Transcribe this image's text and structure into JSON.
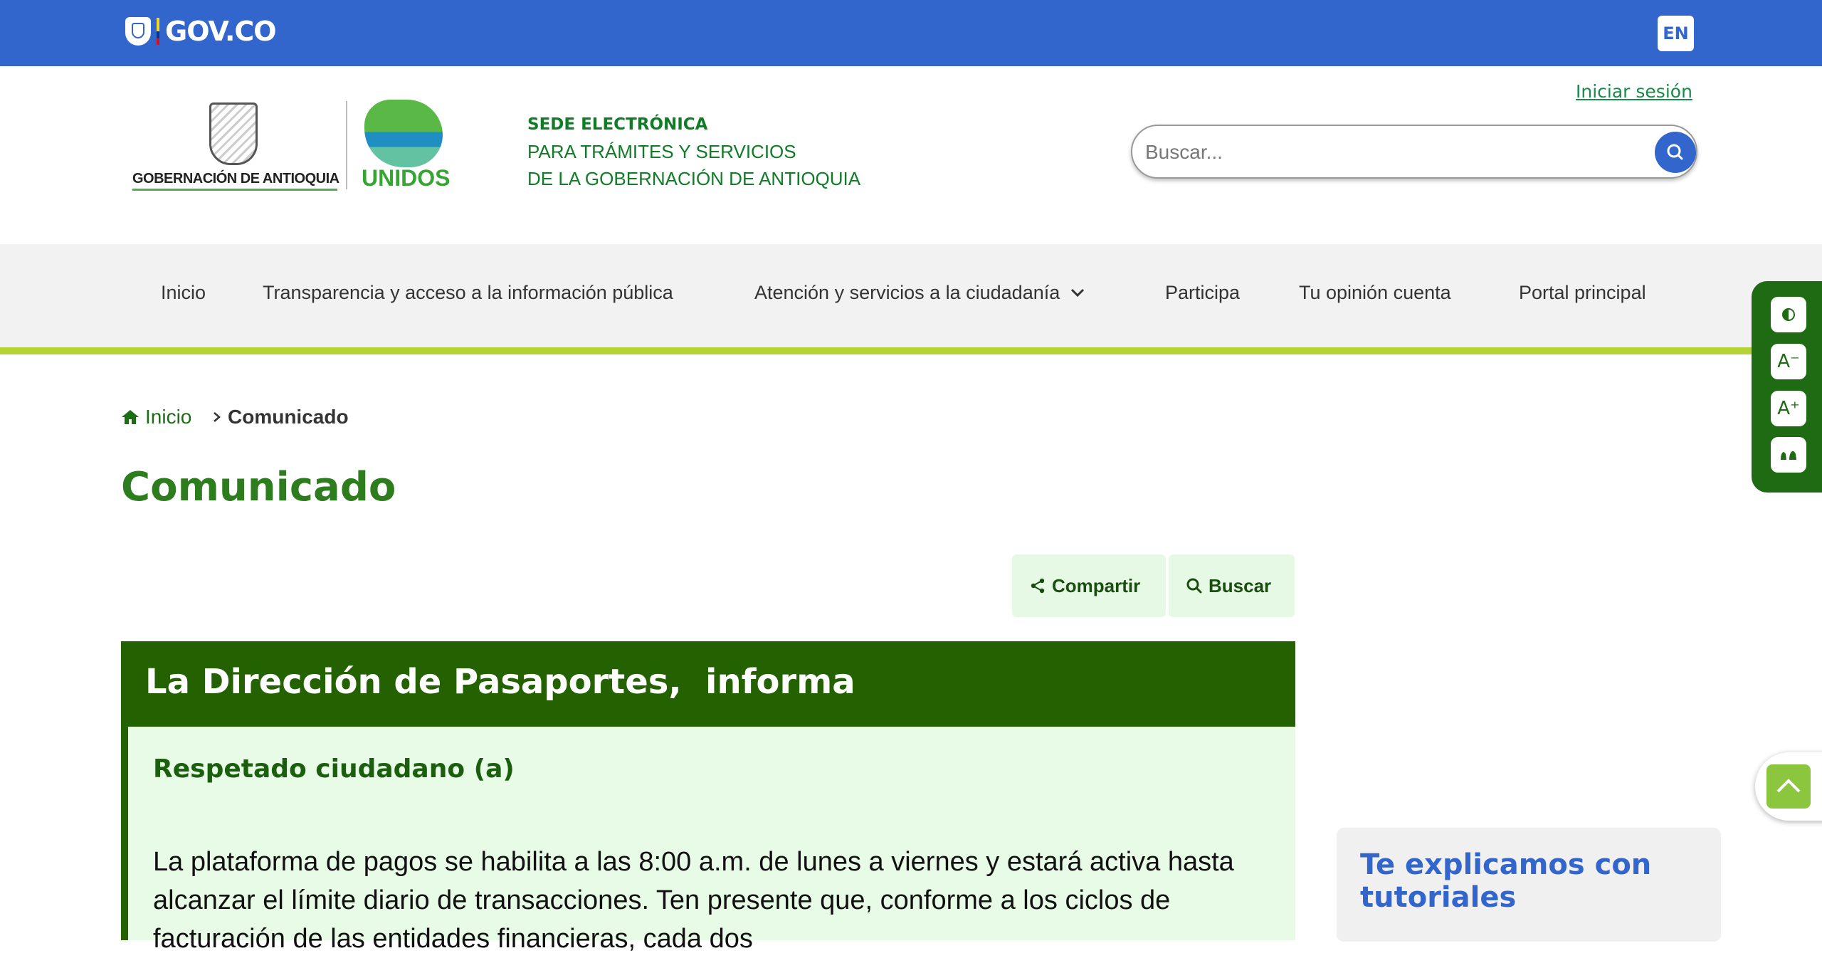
{
  "gov_bar": {
    "logo_text": "GOV.CO",
    "language_button": "EN"
  },
  "header": {
    "login_link": "Iniciar sesión",
    "gov_logo_text": "GOBERNACIÓN DE ANTIOQUIA",
    "unidos_logo_text": "UNIDOS",
    "sede_line1": "SEDE ELECTRÓNICA",
    "sede_line2": "PARA TRÁMITES Y SERVICIOS",
    "sede_line3": "DE LA GOBERNACIÓN DE ANTIOQUIA",
    "search_placeholder": "Buscar..."
  },
  "nav": {
    "items": [
      "Inicio",
      "Transparencia y acceso a la información pública",
      "Atención y servicios a la ciudadanía",
      "Participa",
      "Tu opinión cuenta",
      "Portal principal"
    ]
  },
  "accessibility": {
    "icons": [
      "contrast-icon",
      "decrease-font-icon",
      "increase-font-icon",
      "sign-language-icon"
    ]
  },
  "breadcrumb": {
    "home": "Inicio",
    "current": "Comunicado"
  },
  "page": {
    "title": "Comunicado"
  },
  "actions": {
    "share": "Compartir",
    "search": "Buscar"
  },
  "announcement": {
    "title": "La Dirección de Pasaportes,  informa",
    "greeting": "Respetado ciudadano (a)",
    "body": "La plataforma de pagos se habilita a las 8:00 a.m. de lunes a viernes y estará activa hasta alcanzar el límite diario de transacciones. Ten presente que, conforme a los ciclos de facturación de las entidades financieras, cada dos"
  },
  "sidebar": {
    "tutorials_title": "Te explicamos con tutoriales"
  },
  "colors": {
    "gov_blue": "#3366cc",
    "dark_green": "#236101",
    "lime": "#b4d334"
  }
}
